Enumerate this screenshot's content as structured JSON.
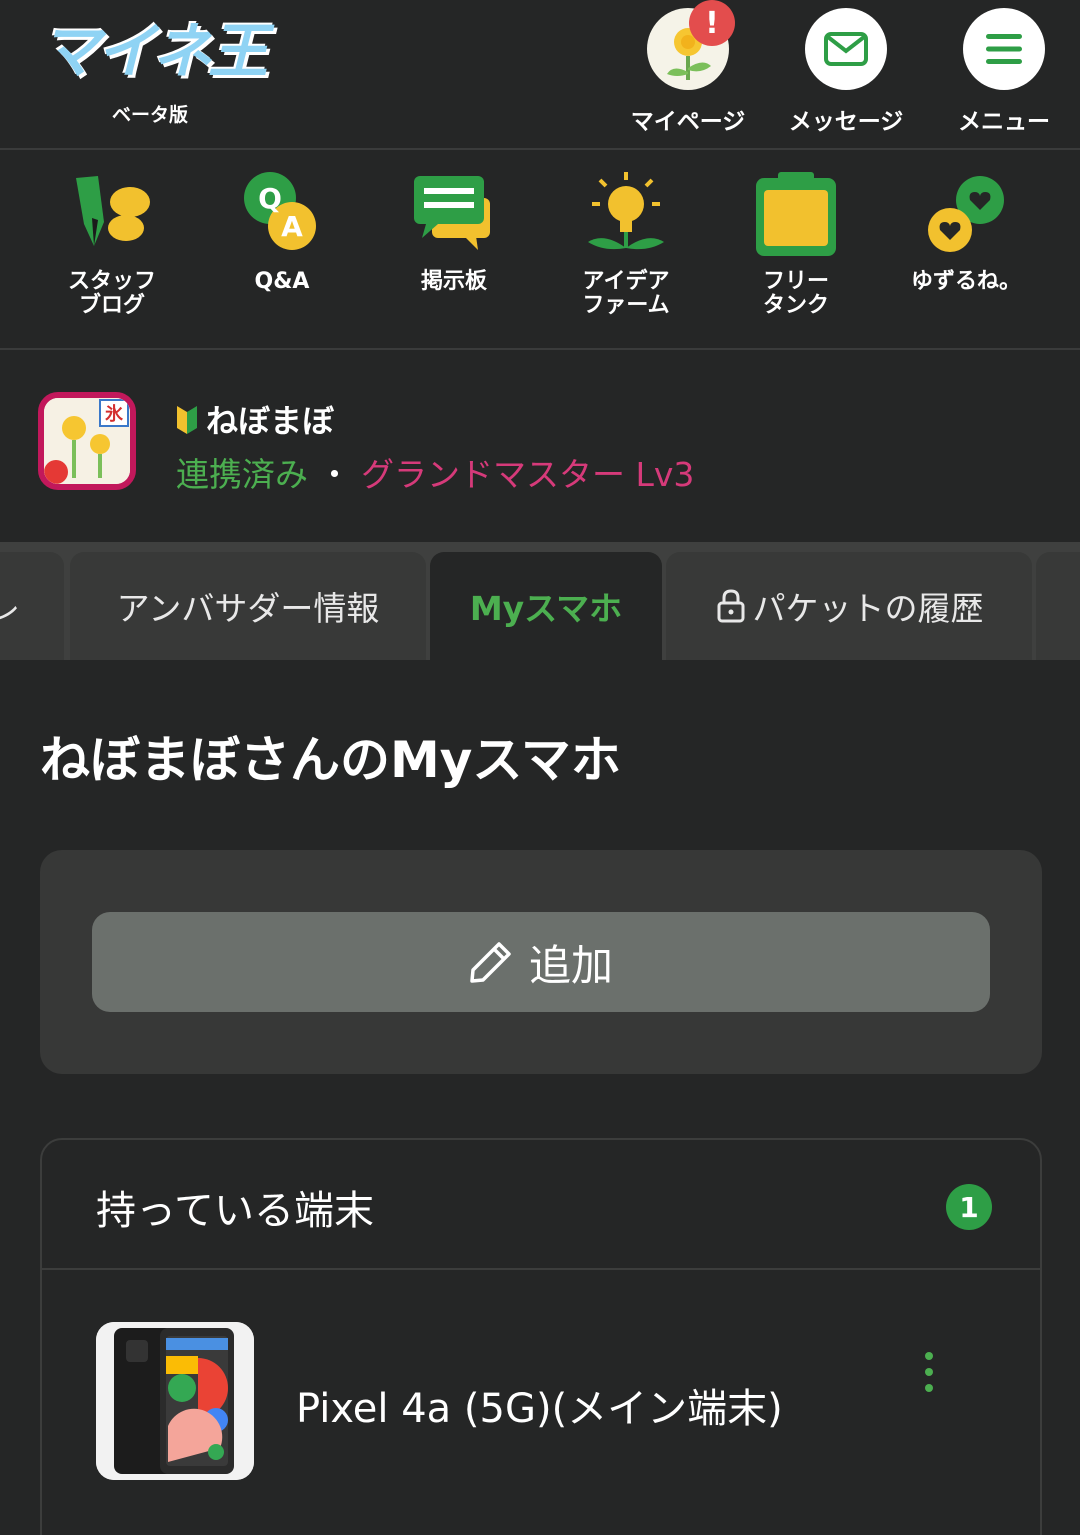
{
  "header": {
    "logo_text": "マイネ王",
    "logo_sub": "ベータ版",
    "buttons": [
      {
        "label": "マイページ",
        "icon": "dandelion-avatar-icon",
        "badge": "!"
      },
      {
        "label": "メッセージ",
        "icon": "envelope-icon"
      },
      {
        "label": "メニュー",
        "icon": "hamburger-icon"
      }
    ]
  },
  "nav": {
    "items": [
      {
        "label": "スタッフ\nブログ",
        "icon": "pen-chat-icon"
      },
      {
        "label": "Q&A",
        "icon": "qa-bubbles-icon",
        "q": "Q",
        "a": "A"
      },
      {
        "label": "掲示板",
        "icon": "board-chat-icon"
      },
      {
        "label": "アイデア\nファーム",
        "icon": "lightbulb-sprout-icon"
      },
      {
        "label": "フリー\nタンク",
        "icon": "tank-icon"
      },
      {
        "label": "ゆずるね。",
        "icon": "heart-bubbles-icon"
      }
    ]
  },
  "profile": {
    "name": "ねぼまぼ",
    "linked": "連携済み",
    "separator": "・",
    "rank": "グランドマスター Lv3"
  },
  "tabs": [
    {
      "label": "レ"
    },
    {
      "label": "アンバサダー情報"
    },
    {
      "label": "Myスマホ",
      "active": true
    },
    {
      "label": "パケットの履歴",
      "locked": true
    },
    {
      "label": ""
    }
  ],
  "page_title": "ねぼまぼさんのMyスマホ",
  "add_button_label": "追加",
  "devices": {
    "title": "持っている端末",
    "count": "1",
    "items": [
      {
        "name": "Pixel 4a (5G)(メイン端末)"
      }
    ]
  },
  "colors": {
    "background": "#252626",
    "accent_green": "#4caf50",
    "rank_pink": "#d63a7a",
    "badge_red": "#e34d4d"
  }
}
